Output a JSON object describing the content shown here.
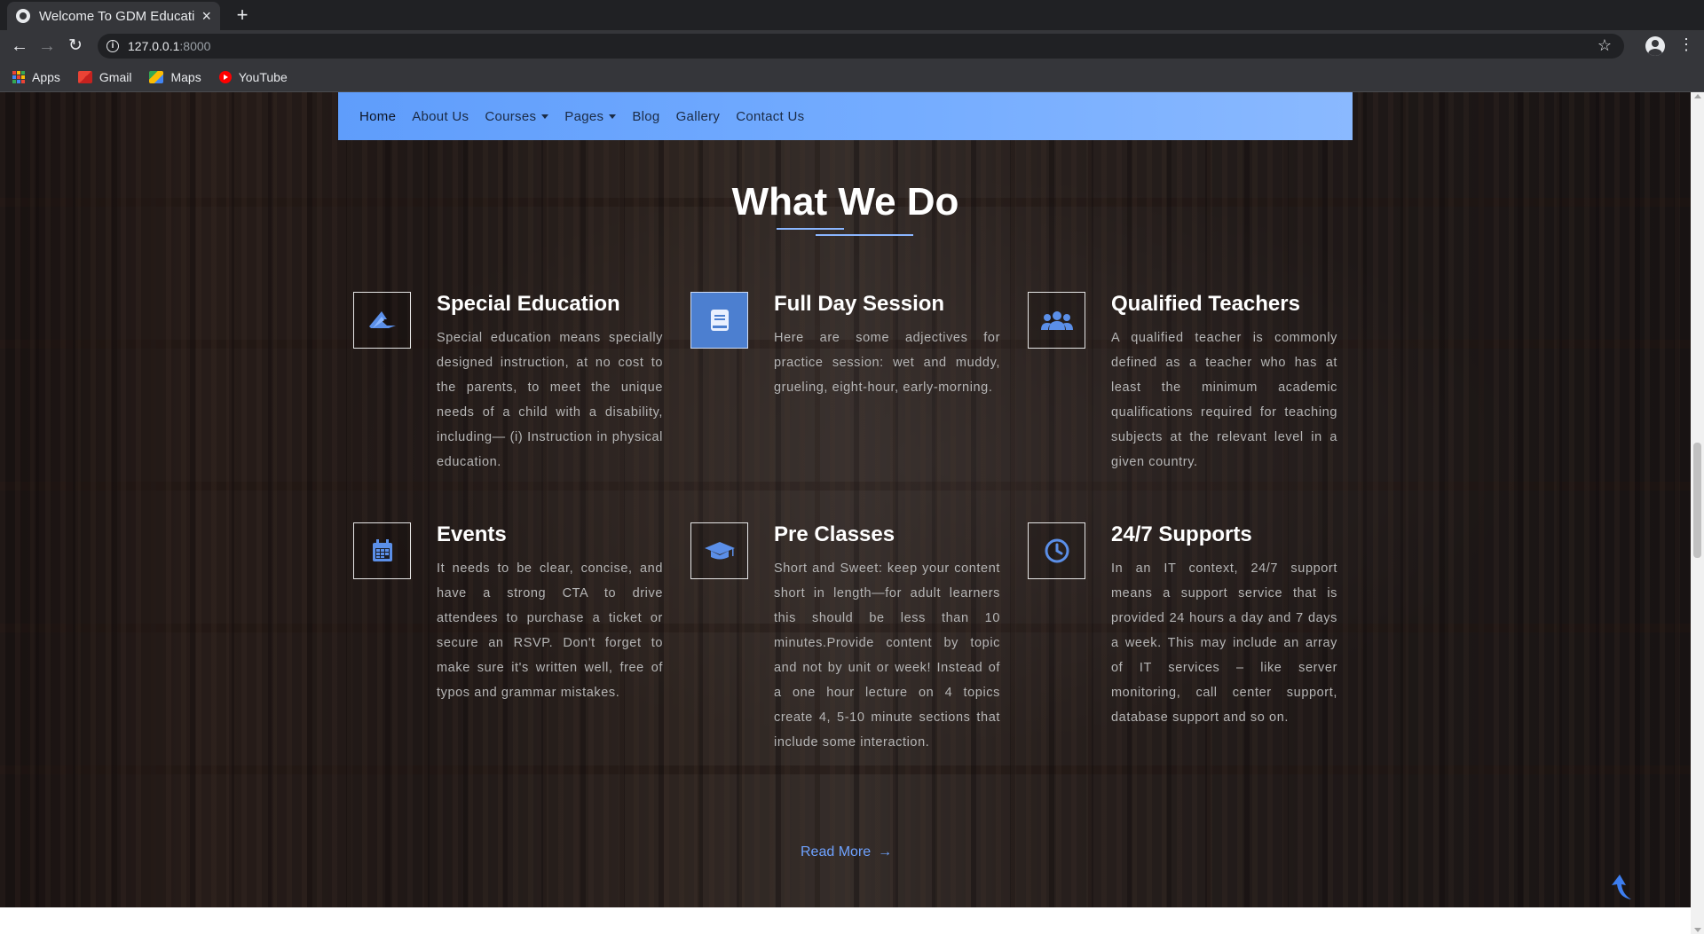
{
  "browser": {
    "tab_title": "Welcome To GDM Educati",
    "close_symbol": "×",
    "new_tab_symbol": "+",
    "url_host": "127.0.0.1",
    "url_port": ":8000",
    "bookmarks": [
      {
        "label": "Apps",
        "icon": "apps-grid-icon"
      },
      {
        "label": "Gmail",
        "icon": "gmail-icon"
      },
      {
        "label": "Maps",
        "icon": "maps-icon"
      },
      {
        "label": "YouTube",
        "icon": "youtube-icon"
      }
    ]
  },
  "nav": {
    "items": [
      {
        "label": "Home",
        "active": true
      },
      {
        "label": "About Us"
      },
      {
        "label": "Courses",
        "dropdown": true
      },
      {
        "label": "Pages",
        "dropdown": true
      },
      {
        "label": "Blog"
      },
      {
        "label": "Gallery"
      },
      {
        "label": "Contact Us"
      }
    ],
    "gradient_start": "#5f9dfb",
    "gradient_end": "#8ab9ff"
  },
  "section": {
    "title_light": "What We ",
    "title_bold": "Do",
    "accent_color": "#8ab6ff"
  },
  "features": [
    {
      "title": "Special Education",
      "icon": "graduation-swoosh-icon",
      "text": "Special education means specially designed instruction, at no cost to the parents, to meet the unique needs of a child with a disability, including— (i) Instruction in physical education."
    },
    {
      "title": "Full Day Session",
      "icon": "book-icon",
      "text": "Here are some adjectives for practice session: wet and muddy, grueling, eight-hour, early-morning."
    },
    {
      "title": "Qualified Teachers",
      "icon": "users-icon",
      "text": "A qualified teacher is commonly defined as a teacher who has at least the minimum academic qualifications required for teaching subjects at the relevant level in a given country."
    },
    {
      "title": "Events",
      "icon": "calendar-icon",
      "text": "It needs to be clear, concise, and have a strong CTA to drive attendees to purchase a ticket or secure an RSVP. Don't forget to make sure it's written well, free of typos and grammar mistakes."
    },
    {
      "title": "Pre Classes",
      "icon": "mortarboard-icon",
      "text": "Short and Sweet: keep your content short in length—for adult learners this should be less than 10 minutes.Provide content by topic and not by unit or week! Instead of a one hour lecture on 4 topics create 4, 5-10 minute sections that include some interaction."
    },
    {
      "title": "24/7 Supports",
      "icon": "clock-icon",
      "text": "In an IT context, 24/7 support means a support service that is provided 24 hours a day and 7 days a week. This may include an array of IT services – like server monitoring, call center support, database support and so on."
    }
  ],
  "read_more": {
    "label": "Read More",
    "arrow": "→"
  }
}
